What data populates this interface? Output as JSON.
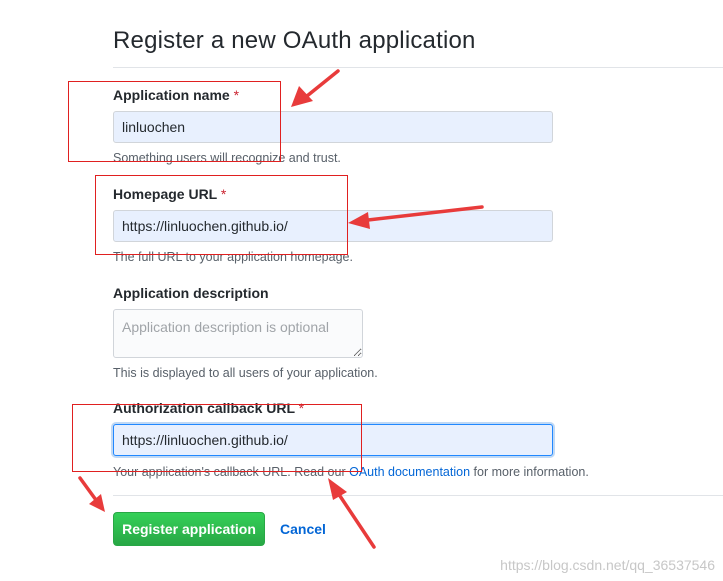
{
  "page": {
    "title": "Register a new OAuth application"
  },
  "fields": {
    "app_name": {
      "label": "Application name",
      "required_mark": "*",
      "value": "linluochen",
      "note": "Something users will recognize and trust."
    },
    "homepage_url": {
      "label": "Homepage URL",
      "required_mark": "*",
      "value": "https://linluochen.github.io/",
      "note": "The full URL to your application homepage."
    },
    "description": {
      "label": "Application description",
      "placeholder": "Application description is optional",
      "note": "This is displayed to all users of your application."
    },
    "callback_url": {
      "label": "Authorization callback URL",
      "required_mark": "*",
      "value": "https://linluochen.github.io/",
      "note_prefix": "Your application's callback URL. Read our",
      "note_link": "OAuth documentation",
      "note_suffix": "for more information."
    }
  },
  "actions": {
    "register_label": "Register application",
    "cancel_label": "Cancel"
  },
  "annotation": {
    "color": "#e02020"
  },
  "watermark": "https://blog.csdn.net/qq_36537546",
  "colors": {
    "primary_button": "#28a745",
    "link": "#0366d6",
    "required": "#cb2431",
    "autofill_bg": "#e8f0fe"
  }
}
